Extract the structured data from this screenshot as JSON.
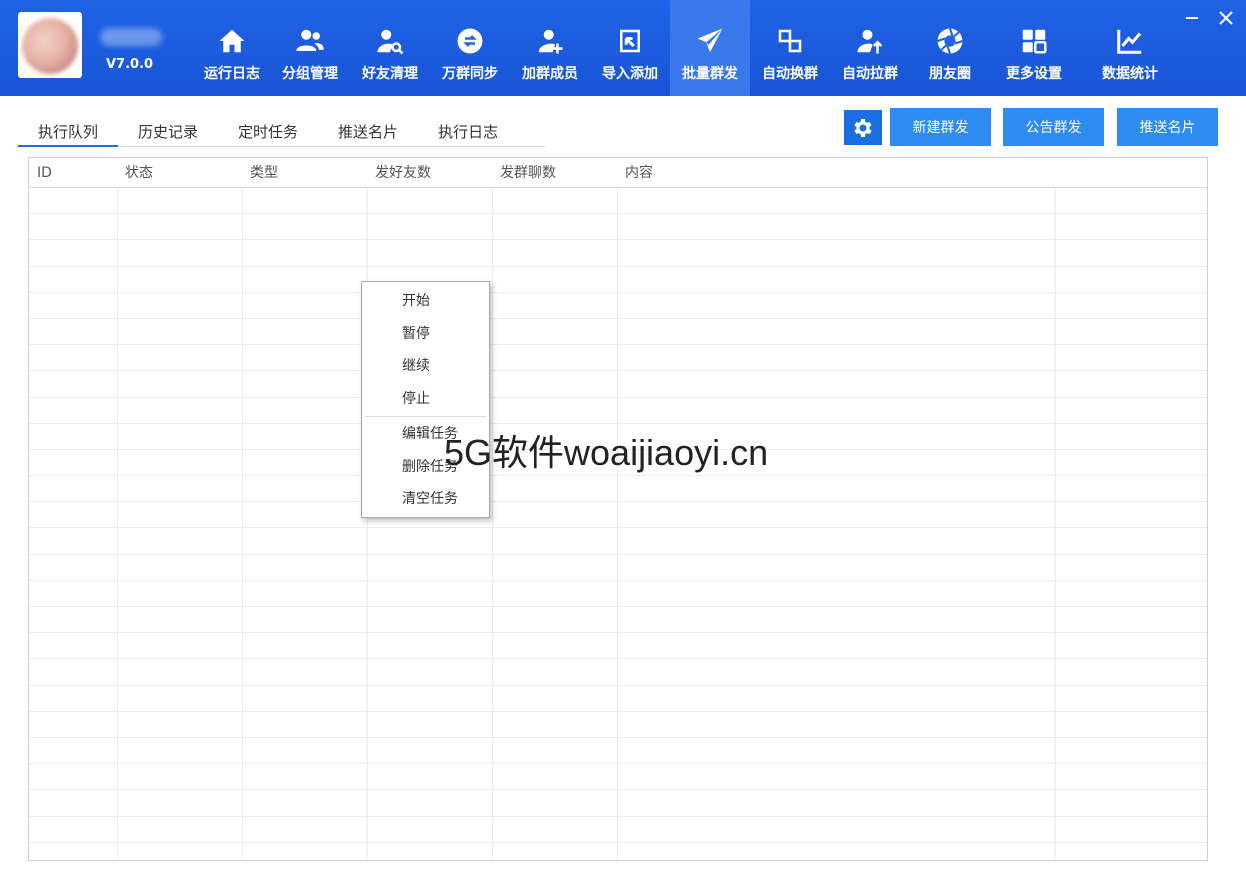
{
  "app": {
    "version": "V7.0.0",
    "minimize_glyph": "—",
    "close_glyph": "✕"
  },
  "nav": [
    {
      "label": "运行日志",
      "icon": "home-icon"
    },
    {
      "label": "分组管理",
      "icon": "users-icon"
    },
    {
      "label": "好友清理",
      "icon": "user-search-icon"
    },
    {
      "label": "万群同步",
      "icon": "sync-icon"
    },
    {
      "label": "加群成员",
      "icon": "user-add-icon"
    },
    {
      "label": "导入添加",
      "icon": "import-icon"
    },
    {
      "label": "批量群发",
      "icon": "send-icon",
      "active": true
    },
    {
      "label": "自动换群",
      "icon": "swap-icon"
    },
    {
      "label": "自动拉群",
      "icon": "user-up-icon"
    },
    {
      "label": "朋友圈",
      "icon": "aperture-icon"
    },
    {
      "label": "更多设置",
      "icon": "grid-icon"
    },
    {
      "label": "数据统计",
      "icon": "chart-icon"
    }
  ],
  "tabs": [
    {
      "label": "执行队列",
      "active": true
    },
    {
      "label": "历史记录"
    },
    {
      "label": "定时任务"
    },
    {
      "label": "推送名片"
    },
    {
      "label": "执行日志"
    }
  ],
  "actions": {
    "settings_icon": "gear-icon",
    "new_broadcast": "新建群发",
    "announcement_broadcast": "公告群发",
    "push_card": "推送名片"
  },
  "table": {
    "columns": [
      "ID",
      "状态",
      "类型",
      "发好友数",
      "发群聊数",
      "内容"
    ],
    "rows": []
  },
  "context_menu": {
    "group1": [
      "开始",
      "暂停",
      "继续",
      "停止"
    ],
    "group2": [
      "编辑任务",
      "删除任务",
      "清空任务"
    ]
  },
  "watermark": "5G软件woaijiaoyi.cn",
  "colors": {
    "topbar": "#1f63e6",
    "nav_active": "#3a78ee",
    "button": "#2d8cf0",
    "gear_button": "#1a6fe0"
  }
}
